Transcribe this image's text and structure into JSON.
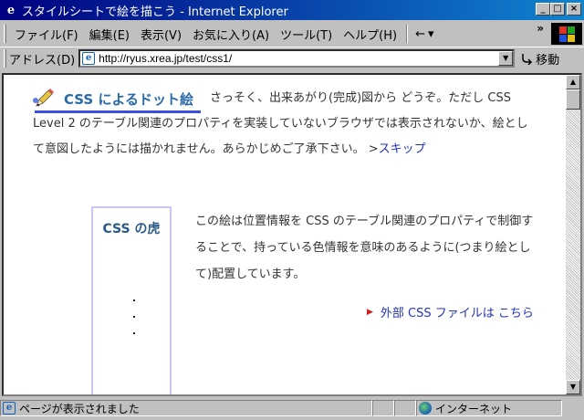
{
  "window": {
    "title": "スタイルシートで絵を描こう - Internet Explorer",
    "min_label": "_",
    "max_label": "□",
    "close_label": "×"
  },
  "menu": {
    "items": [
      "ファイル(F)",
      "編集(E)",
      "表示(V)",
      "お気に入り(A)",
      "ツール(T)",
      "ヘルプ(H)"
    ],
    "back_label": "←",
    "back_arrow": "▾",
    "chevron": "»"
  },
  "address": {
    "label": "アドレス(D)",
    "value": "http://ryus.xrea.jp/test/css1/",
    "go_label": "移動"
  },
  "page": {
    "heading": "CSS によるドット絵",
    "intro_text": "さっそく、出来あがり(完成)図から どうぞ。ただし CSS Level 2 のテーブル関連のプロパティを実装していないブラウザでは表示されないか、絵として意図したようには描かれません。あらかじめご了承下さい。 >",
    "skip_link": "スキップ",
    "tiger_title": "CSS の虎",
    "description": "この絵は位置情報を CSS のテーブル関連のプロパティで制御することで、持っている色情報を意味のあるように(つまり絵として)配置しています。",
    "external_link": "外部 CSS ファイルは こちら"
  },
  "status": {
    "text": "ページが表示されました",
    "zone": "インターネット"
  }
}
